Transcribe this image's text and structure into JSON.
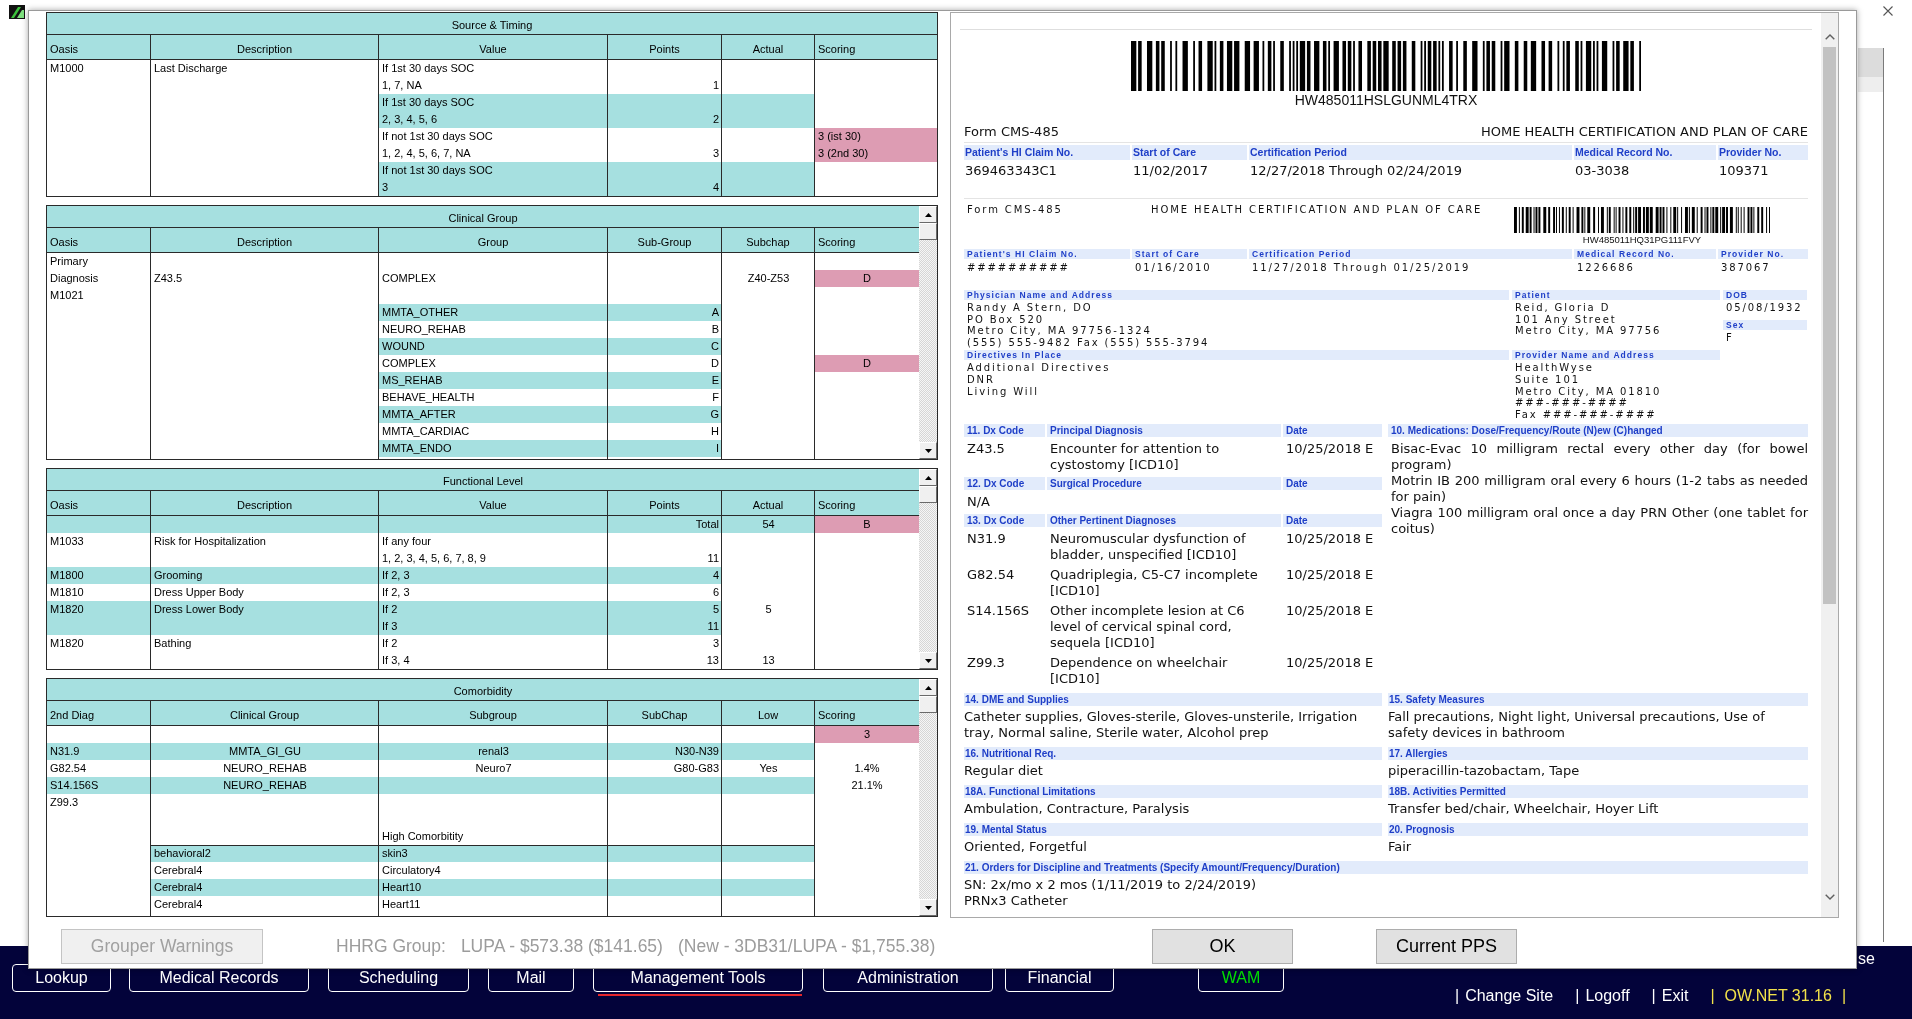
{
  "dialog": {
    "source_timing": {
      "title": "Source & Timing",
      "columns": [
        "Oasis",
        "Description",
        "Value",
        "Points",
        "Actual",
        "Scoring"
      ],
      "oasis": "M1000",
      "description": "Last Discharge",
      "options": [
        {
          "condition": "If 1st 30 days SOC",
          "responses": "1, 7, NA",
          "points": "1",
          "selected": false
        },
        {
          "condition": "If 1st 30 days SOC",
          "responses": "2, 3, 4, 5, 6",
          "points": "2",
          "selected": false
        },
        {
          "condition": "If not 1st 30 days SOC",
          "responses": "1, 2, 4, 5, 6, 7, NA",
          "points": "3",
          "selected": true,
          "scoring": [
            "3 (ist 30)",
            "3 (2nd 30)"
          ]
        },
        {
          "condition": "If not 1st 30 days SOC",
          "responses": "3",
          "points": "4",
          "selected": false
        }
      ]
    },
    "clinical_group": {
      "title": "Clinical Group",
      "columns": [
        "Oasis",
        "Description",
        "Group",
        "Sub-Group",
        "Subchap",
        "Scoring"
      ],
      "primary": {
        "oasis": [
          "Primary",
          "Diagnosis",
          "M1021"
        ],
        "description": "Z43.5",
        "group": "COMPLEX",
        "subchap": "Z40-Z53",
        "scoring": "D",
        "selected": true
      },
      "groups": [
        {
          "group": "MMTA_OTHER",
          "sub_group": "A",
          "selected": false
        },
        {
          "group": "NEURO_REHAB",
          "sub_group": "B",
          "selected": false
        },
        {
          "group": "WOUND",
          "sub_group": "C",
          "selected": false
        },
        {
          "group": "COMPLEX",
          "sub_group": "D",
          "selected": true,
          "scoring": "D"
        },
        {
          "group": "MS_REHAB",
          "sub_group": "E",
          "selected": false
        },
        {
          "group": "BEHAVE_HEALTH",
          "sub_group": "F",
          "selected": false
        },
        {
          "group": "MMTA_AFTER",
          "sub_group": "G",
          "selected": false
        },
        {
          "group": "MMTA_CARDIAC",
          "sub_group": "H",
          "selected": false
        },
        {
          "group": "MMTA_ENDO",
          "sub_group": "I",
          "selected": false
        }
      ]
    },
    "functional_level": {
      "title": "Functional Level",
      "columns": [
        "Oasis",
        "Description",
        "Value",
        "Points",
        "Actual",
        "Scoring"
      ],
      "total": {
        "label": "Total",
        "actual": "54",
        "scoring": "B",
        "selected": true
      },
      "items": [
        {
          "oasis": "M1033",
          "description": "Risk for Hospitalization",
          "lines": [
            {
              "value": "If any four"
            },
            {
              "value": "1, 2, 3, 4, 5, 6, 7, 8, 9",
              "points": "11"
            }
          ]
        },
        {
          "oasis": "M1800",
          "description": "Grooming",
          "lines": [
            {
              "value": "If 2, 3",
              "points": "4"
            }
          ]
        },
        {
          "oasis": "M1810",
          "description": "Dress Upper Body",
          "lines": [
            {
              "value": "If 2, 3",
              "points": "6"
            }
          ]
        },
        {
          "oasis": "M1820",
          "description": "Dress Lower Body",
          "lines": [
            {
              "value": "If 2",
              "points": "5",
              "actual": "5"
            },
            {
              "value": "If 3",
              "points": "11"
            }
          ]
        },
        {
          "oasis": "M1820",
          "description": "Bathing",
          "lines": [
            {
              "value": "If 2",
              "points": "3"
            },
            {
              "value": "If 3, 4",
              "points": "13",
              "actual": "13"
            }
          ]
        }
      ]
    },
    "comorbidity": {
      "title": "Comorbidity",
      "columns": [
        "2nd Diag",
        "Clinical Group",
        "Subgroup",
        "SubChap",
        "Low",
        "Scoring"
      ],
      "scoring": "3",
      "selected": true,
      "diagnoses": [
        {
          "code": "N31.9",
          "clinical_group": "MMTA_GI_GU",
          "subgroup": "renal3",
          "subchap": "N30-N39"
        },
        {
          "code": "G82.54",
          "clinical_group": "NEURO_REHAB",
          "subgroup": "Neuro7",
          "subchap": "G80-G83",
          "low": "Yes",
          "scoring": "1.4%"
        },
        {
          "code": "S14.156S",
          "clinical_group": "NEURO_REHAB",
          "scoring": "21.1%"
        },
        {
          "code": "Z99.3"
        }
      ],
      "high_comorbidity": {
        "label": "High Comorbitity",
        "pairs": [
          {
            "clinical_group": "behavioral2",
            "subgroup": "skin3"
          },
          {
            "clinical_group": "Cerebral4",
            "subgroup": "Circulatory4"
          },
          {
            "clinical_group": "Cerebral4",
            "subgroup": "Heart10"
          },
          {
            "clinical_group": "Cerebral4",
            "subgroup": "Heart11"
          }
        ]
      }
    },
    "form_preview": {
      "barcode_text": "HW485011HSLGUNML4TRX",
      "form_number": "Form CMS-485",
      "heading": "HOME HEALTH CERTIFICATION AND PLAN OF CARE",
      "fields": [
        {
          "label": "Patient's HI Claim No.",
          "value": "369463343C1"
        },
        {
          "label": "Start of Care",
          "value": "11/02/2017"
        },
        {
          "label": "Certification Period",
          "value": "12/27/2018 Through 02/24/2019"
        },
        {
          "label": "Medical Record No.",
          "value": "03-3038"
        },
        {
          "label": "Provider No.",
          "value": "109371"
        }
      ],
      "previous_form": {
        "form_number": "Form CMS-485",
        "heading": "HOME HEALTH CERTIFICATION AND PLAN OF CARE",
        "barcode_text": "HW485011HQ31PG111FVY",
        "fields": [
          {
            "label": "Patient's HI Claim No.",
            "value": "##########"
          },
          {
            "label": "Start of Care",
            "value": "01/16/2010"
          },
          {
            "label": "Certification Period",
            "value": "11/27/2018 Through 01/25/2019"
          },
          {
            "label": "Medical Record No.",
            "value": "1226686"
          },
          {
            "label": "Provider No.",
            "value": "387067"
          }
        ],
        "physician": {
          "label": "Physician Name and Address",
          "lines": [
            "Randy A Stern, DO",
            "PO Box 520",
            "Metro City, MA 97756-1324",
            "(555) 555-9482 Fax (555) 555-3794"
          ]
        },
        "patient": {
          "label": "Patient",
          "lines": [
            "Reid, Gloria D",
            "101 Any Street",
            "Metro City, MA 97756"
          ]
        },
        "dob": {
          "label": "DOB",
          "value": "05/08/1932"
        },
        "sex": {
          "label": "Sex",
          "value": "F"
        },
        "directives": {
          "label": "Directives In Place",
          "lines": [
            "Additional Directives",
            "DNR",
            "Living Will"
          ]
        },
        "provider": {
          "label": "Provider Name and Address",
          "lines": [
            "HealthWyse",
            "Suite 101",
            "Metro City, MA 01810",
            "###-###-####",
            "Fax ###-###-####"
          ]
        }
      },
      "diagnoses": [
        {
          "headers": [
            "11. Dx Code",
            "Principal Diagnosis",
            "Date"
          ],
          "entries": [
            {
              "code": "Z43.5",
              "description": "Encounter for attention to cystostomy [ICD10]",
              "date": "10/25/2018 E"
            }
          ]
        },
        {
          "headers": [
            "12. Dx Code",
            "Surgical Procedure",
            "Date"
          ],
          "entries": [
            {
              "code": "N/A"
            }
          ]
        },
        {
          "headers": [
            "13. Dx Code",
            "Other Pertinent Diagnoses",
            "Date"
          ],
          "entries": [
            {
              "code": "N31.9",
              "description": "Neuromuscular dysfunction of bladder, unspecified [ICD10]",
              "date": "10/25/2018 E"
            },
            {
              "code": "G82.54",
              "description": "Quadriplegia, C5-C7 incomplete [ICD10]",
              "date": "10/25/2018 E"
            },
            {
              "code": "S14.156S",
              "description": "Other incomplete lesion at C6 level of cervical spinal cord, sequela [ICD10]",
              "date": "10/25/2018 E"
            },
            {
              "code": "Z99.3",
              "description": "Dependence on wheelchair [ICD10]",
              "date": "10/25/2018 E"
            }
          ]
        }
      ],
      "medications": {
        "label": "10. Medications: Dose/Frequency/Route (N)ew (C)hanged",
        "items": [
          "Bisac-Evac 10 milligram rectal every other day (for bowel program)",
          "Motrin IB 200 milligram oral every 6 hours (1-2 tabs as needed for pain)",
          "Viagra 100 milligram oral once a day PRN Other (one tablet for coitus)"
        ]
      },
      "sections": [
        {
          "label": "14. DME and Supplies",
          "text": "Catheter supplies, Gloves-sterile, Gloves-unsterile, Irrigation tray, Normal saline, Sterile water, Alcohol prep"
        },
        {
          "label": "15. Safety Measures",
          "text": "Fall precautions, Night light, Universal precautions, Use of safety devices in bathroom"
        },
        {
          "label": "16. Nutritional Req.",
          "text": "Regular diet"
        },
        {
          "label": "17. Allergies",
          "text": "piperacillin-tazobactam, Tape"
        },
        {
          "label": "18A. Functional Limitations",
          "text": "Ambulation, Contracture, Paralysis"
        },
        {
          "label": "18B. Activities Permitted",
          "text": "Transfer bed/chair, Wheelchair, Hoyer Lift"
        },
        {
          "label": "19. Mental Status",
          "text": "Oriented, Forgetful"
        },
        {
          "label": "20. Prognosis",
          "text": "Fair"
        }
      ],
      "orders": {
        "label": "21. Orders for Discipline and Treatments (Specify Amount/Frequency/Duration)",
        "lines": [
          "SN: 2x/mo x 2 mos (1/11/2019 to 2/24/2019)",
          "PRNx3 Catheter"
        ]
      }
    },
    "grouper_warnings": {
      "label": "Grouper Warnings",
      "disabled": true
    },
    "hhrg": {
      "label": "HHRG Group:",
      "current": "LUPA - $573.38 ($141.65)",
      "new": "(New - 3DB31/LUPA - $1,755.38)"
    },
    "buttons": [
      {
        "label": "OK"
      },
      {
        "label": "Current PPS"
      }
    ]
  },
  "nav": {
    "items": [
      {
        "label": "Lookup",
        "selected": false,
        "color": "#ffffff"
      },
      {
        "label": "Medical Records",
        "selected": false,
        "color": "#ffffff"
      },
      {
        "label": "Scheduling",
        "selected": false,
        "color": "#ffffff"
      },
      {
        "label": "Mail",
        "selected": false,
        "color": "#ffffff"
      },
      {
        "label": "Management Tools",
        "selected": true,
        "color": "#ffffff"
      },
      {
        "label": "Administration",
        "selected": false,
        "color": "#ffffff"
      },
      {
        "label": "Financial",
        "selected": false,
        "color": "#ffffff"
      },
      {
        "label": "WAM",
        "selected": false,
        "color": "#00e000"
      }
    ],
    "links": [
      {
        "kind": "link",
        "separator": "|",
        "label": "Change Site"
      },
      {
        "kind": "link",
        "separator": "|",
        "label": "Logoff"
      },
      {
        "kind": "link",
        "separator": "|",
        "label": "Exit"
      },
      {
        "kind": "version",
        "separator": "|",
        "label": "OW.NET 31.16",
        "end_separator": "|"
      }
    ],
    "cut_label": "se"
  }
}
